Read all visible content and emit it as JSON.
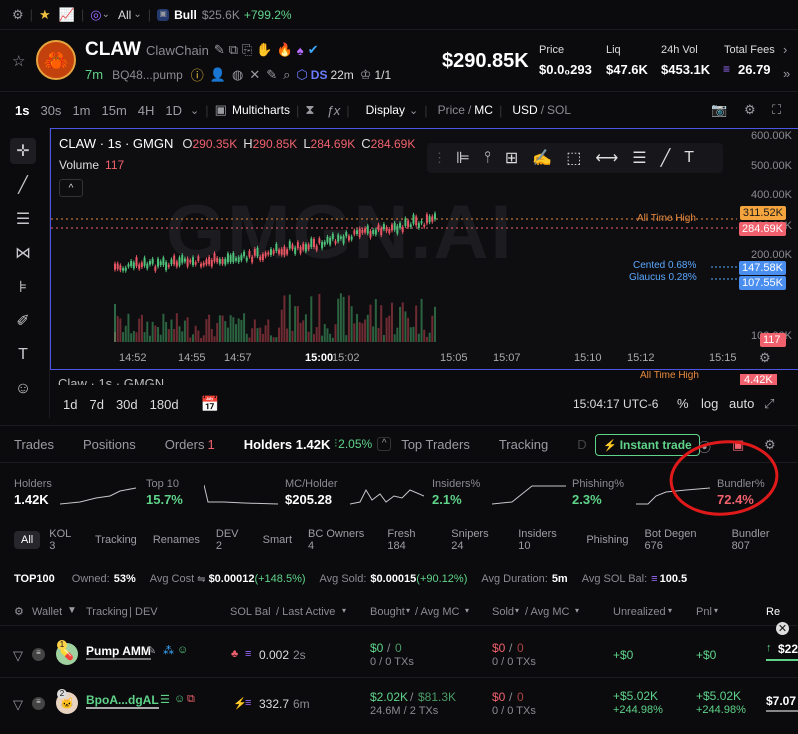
{
  "topbar": {
    "network": "All",
    "ticker": "Bull",
    "ticker_mc": "$25.6K",
    "ticker_change": "+799.2%"
  },
  "token": {
    "symbol": "CLAW",
    "chain_name": "ClawChain",
    "age": "7m",
    "address": "BQ48...pump",
    "ds_label": "DS",
    "holders_small": "22m",
    "ratio": "1/1",
    "market_cap": "$290.85K",
    "price_label": "Price",
    "price_value": "$0.0₀293",
    "liq_label": "Liq",
    "liq_value": "$47.6K",
    "vol_label": "24h Vol",
    "vol_value": "$453.1K",
    "fees_label": "Total Fees",
    "fees_value": "26.79"
  },
  "toolbar": {
    "intervals": [
      "1s",
      "30s",
      "1m",
      "15m",
      "4H",
      "1D"
    ],
    "multicharts": "Multicharts",
    "display": "Display",
    "price_mc_a": "Price",
    "price_mc_b": "MC",
    "usd": "USD",
    "sol": "SOL"
  },
  "chart": {
    "title": "CLAW · 1s · GMGN",
    "o_label": "O",
    "o_val": "290.35K",
    "h_label": "H",
    "h_val": "290.85K",
    "l_label": "L",
    "l_val": "284.69K",
    "c_label": "C",
    "c_val": "284.69K",
    "volume_label": "Volume",
    "volume_val": "117",
    "watermark": "GMGN.AI",
    "ath_label": "All Time High",
    "ath_tag": "311.52K",
    "price_tag": "284.69K",
    "cented_label": "Cented 0.68%",
    "glaucus_label": "Glaucus 0.28%",
    "cented_tag": "147.58K",
    "glaucus_tag": "107.55K",
    "vol_tag": "117",
    "y_ticks": [
      "600.00K",
      "500.00K",
      "400.00K",
      "300.00K",
      "200.00K",
      "100.00K"
    ],
    "x_ticks": [
      "14:52",
      "14:55",
      "14:57",
      "15:00",
      "15:02",
      "15:05",
      "15:07",
      "15:10",
      "15:12",
      "15:15"
    ],
    "ghost_title": "Claw · 1s · GMGN",
    "ghost_ath": "All Time High",
    "ghost_tag": "4.42K"
  },
  "chart_data": {
    "type": "candlestick",
    "title": "CLAW · 1s · GMGN",
    "series": [
      {
        "name": "Price",
        "values": [
          110,
          112,
          118,
          121,
          125,
          130,
          128,
          140,
          150,
          160,
          175,
          185,
          195,
          210,
          225,
          240,
          250,
          262,
          270,
          284.69
        ]
      }
    ],
    "ylim": [
      0,
      600
    ],
    "y_unit": "K"
  },
  "rangebar": {
    "ranges": [
      "1d",
      "7d",
      "30d",
      "180d"
    ],
    "time": "15:04:17 UTC-6",
    "pct": "%",
    "log": "log",
    "auto": "auto"
  },
  "tabs": {
    "items": [
      "Trades",
      "Positions",
      "Orders",
      "Holders 1.42K",
      "Top Traders",
      "Tracking",
      "D"
    ],
    "orders_count": "1",
    "holders_pct": "2.05%",
    "instant_trade": "Instant trade"
  },
  "stats": [
    {
      "label": "Holders",
      "value": "1.42K",
      "color": "#ffffff"
    },
    {
      "label": "Top 10",
      "value": "15.7%",
      "color": "#5fd38a"
    },
    {
      "label": "MC/Holder",
      "value": "$205.28",
      "color": "#ffffff"
    },
    {
      "label": "Insiders%",
      "value": "2.1%",
      "color": "#5fd38a"
    },
    {
      "label": "Phishing%",
      "value": "2.3%",
      "color": "#5fd38a"
    },
    {
      "label": "Bundler%",
      "value": "72.4%",
      "color": "#f0616d"
    }
  ],
  "filters": [
    "All",
    "KOL 3",
    "Tracking",
    "Renames",
    "DEV 2",
    "Smart",
    "BC Owners 4",
    "Fresh 184",
    "Snipers 24",
    "Insiders 10",
    "Phishing",
    "Bot Degen 676",
    "Bundler 807"
  ],
  "summary": {
    "top": "TOP100",
    "owned_label": "Owned:",
    "owned_val": "53%",
    "avgcost_label": "Avg Cost",
    "avgcost_val": "$0.00012",
    "avgcost_chg": "(+148.5%)",
    "avgsold_label": "Avg Sold:",
    "avgsold_val": "$0.00015",
    "avgsold_chg": "(+90.12%)",
    "avgdur_label": "Avg Duration:",
    "avgdur_val": "5m",
    "avgsol_label": "Avg SOL Bal:",
    "avgsol_val": "100.5"
  },
  "thead": {
    "wallet": "Wallet",
    "tracking": "Tracking",
    "dev": "DEV",
    "solbal": "SOL Bal",
    "lastactive": "/ Last Active",
    "bought": "Bought",
    "avgmc": "/ Avg MC",
    "sold": "Sold",
    "avgmc2": "/ Avg MC",
    "unrealized": "Unrealized",
    "pnl": "Pnl",
    "rem": "Re"
  },
  "rows": [
    {
      "rank": "1",
      "name": "Pump AMM",
      "sol": "0.002",
      "active": "2s",
      "bought": "$0",
      "bought_mc": "0",
      "bought_tx": "0 / 0 TXs",
      "sold": "$0",
      "sold_mc": "0",
      "sold_tx": "0 / 0 TXs",
      "unreal": "+$0",
      "unreal_pct": "",
      "pnl": "+$0",
      "pnl_pct": "",
      "rem": "$22"
    },
    {
      "rank": "2",
      "name": "BpoA...dgAL",
      "sol": "332.7",
      "active": "6m",
      "bought": "$2.02K",
      "bought_mc": "$81.3K",
      "bought_tx": "24.6M / 2 TXs",
      "sold": "$0",
      "sold_mc": "0",
      "sold_tx": "0 / 0 TXs",
      "unreal": "+$5.02K",
      "unreal_pct": "+244.98%",
      "pnl": "+$5.02K",
      "pnl_pct": "+244.98%",
      "rem": "$7.07"
    }
  ]
}
